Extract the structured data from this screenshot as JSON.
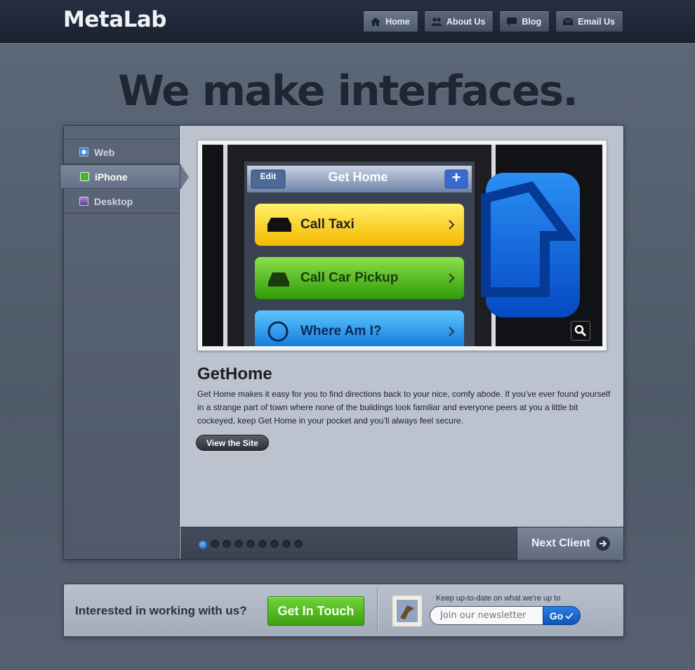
{
  "header": {
    "logo": "MetaLab",
    "nav": [
      {
        "label": "Home",
        "icon": "home-icon"
      },
      {
        "label": "About Us",
        "icon": "people-icon"
      },
      {
        "label": "Blog",
        "icon": "chat-bubble-icon"
      },
      {
        "label": "Email Us",
        "icon": "envelope-icon"
      }
    ]
  },
  "hero": {
    "title": "We make interfaces."
  },
  "sidebar": {
    "items": [
      {
        "label": "Web",
        "icon": "safari-icon"
      },
      {
        "label": "iPhone",
        "icon": "phone-icon"
      },
      {
        "label": "Desktop",
        "icon": "desktop-icon"
      }
    ],
    "active_index": 1
  },
  "showcase": {
    "phone_app": {
      "nav_title": "Get Home",
      "edit_label": "Edit",
      "add_label": "+",
      "rows": [
        {
          "label": "Call Taxi",
          "icon": "taxi-icon",
          "color": "#ffd200"
        },
        {
          "label": "Call Car Pickup",
          "icon": "telephone-icon",
          "color": "#4dbb10"
        },
        {
          "label": "Where Am I?",
          "icon": "crosshair-icon",
          "color": "#1996ee"
        }
      ]
    },
    "title": "GetHome",
    "description": "Get Home makes it easy for you to find directions back to your nice, comfy abode. If you’ve ever found yourself in a strange part of town where none of the buildings look familiar and everyone peers at you a little bit cockeyed, keep Get Home in your pocket and you’ll always feel secure.",
    "view_button": "View the Site",
    "pager": {
      "count": 9,
      "active_index": 0
    },
    "next_button": "Next Client"
  },
  "contact": {
    "text": "Interested in working with us?",
    "button": "Get In Touch",
    "newsletter_caption": "Keep up-to-date on what we’re up to",
    "newsletter_placeholder": "Join our newsletter",
    "go_button": "Go"
  },
  "colors": {
    "accent_blue": "#1b6fd6",
    "accent_green": "#3ea10f",
    "header_bg": "#1a2130"
  }
}
